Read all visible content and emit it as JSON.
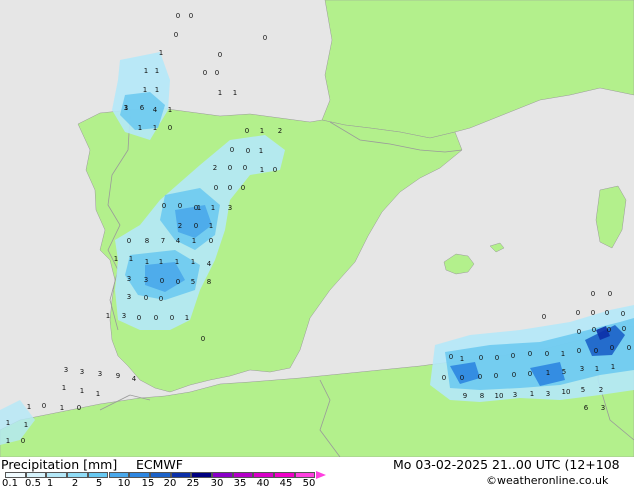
{
  "title": "Precipitation [mm]",
  "model": "ECMWF",
  "datetime": "Mo 03-02-2025 21..00 UTC (12+108",
  "credit": "©weatheronline.co.uk",
  "colors": {
    "sea": "#e6e6e6",
    "land": "#b3f08c",
    "border": "#9a9a9a"
  },
  "legend": {
    "ticks": [
      "0.1",
      "0.5",
      "1",
      "2",
      "5",
      "10",
      "15",
      "20",
      "25",
      "30",
      "35",
      "40",
      "45",
      "50"
    ],
    "swatches": [
      "#f0fbff",
      "#d6f3fc",
      "#b4e8f8",
      "#90dcf6",
      "#68c8f0",
      "#4aa8ea",
      "#2e86e0",
      "#1c62c8",
      "#0c30a8",
      "#000080",
      "#8a00c8",
      "#b400c8",
      "#d800c8",
      "#f000c8",
      "#ff40e0"
    ]
  },
  "values": [
    "0",
    "0",
    "0",
    "1",
    "1",
    "1",
    "1",
    "1",
    "1",
    "0",
    "0",
    "1",
    "1",
    "3",
    "6",
    "4",
    "1",
    "1",
    "1",
    "0",
    "0",
    "0",
    "0",
    "1",
    "2",
    "0",
    "0",
    "1",
    "2",
    "0",
    "0",
    "1",
    "0",
    "0",
    "0",
    "0",
    "1",
    "0",
    "0",
    "0",
    "1",
    "3",
    "2",
    "0",
    "1",
    "0",
    "8",
    "7",
    "4",
    "1",
    "0",
    "1",
    "1",
    "1",
    "1",
    "1",
    "1",
    "4",
    "3",
    "3",
    "0",
    "0",
    "5",
    "8",
    "3",
    "0",
    "0",
    "1",
    "3",
    "0",
    "0",
    "0",
    "1",
    "0",
    "0",
    "0",
    "0",
    "0",
    "0",
    "0",
    "0",
    "0",
    "0",
    "0",
    "0",
    "0",
    "1",
    "0",
    "0",
    "0",
    "0",
    "0",
    "1",
    "0",
    "0",
    "0",
    "0",
    "0",
    "0",
    "0",
    "0",
    "0",
    "0",
    "1",
    "5",
    "3",
    "1",
    "1",
    "9",
    "8",
    "10",
    "3",
    "1",
    "3",
    "10",
    "5",
    "2",
    "6",
    "3",
    "3",
    "3",
    "3",
    "9",
    "4",
    "1",
    "1",
    "1",
    "0",
    "1",
    "0",
    "1",
    "1",
    "1",
    "1",
    "0",
    "0"
  ]
}
